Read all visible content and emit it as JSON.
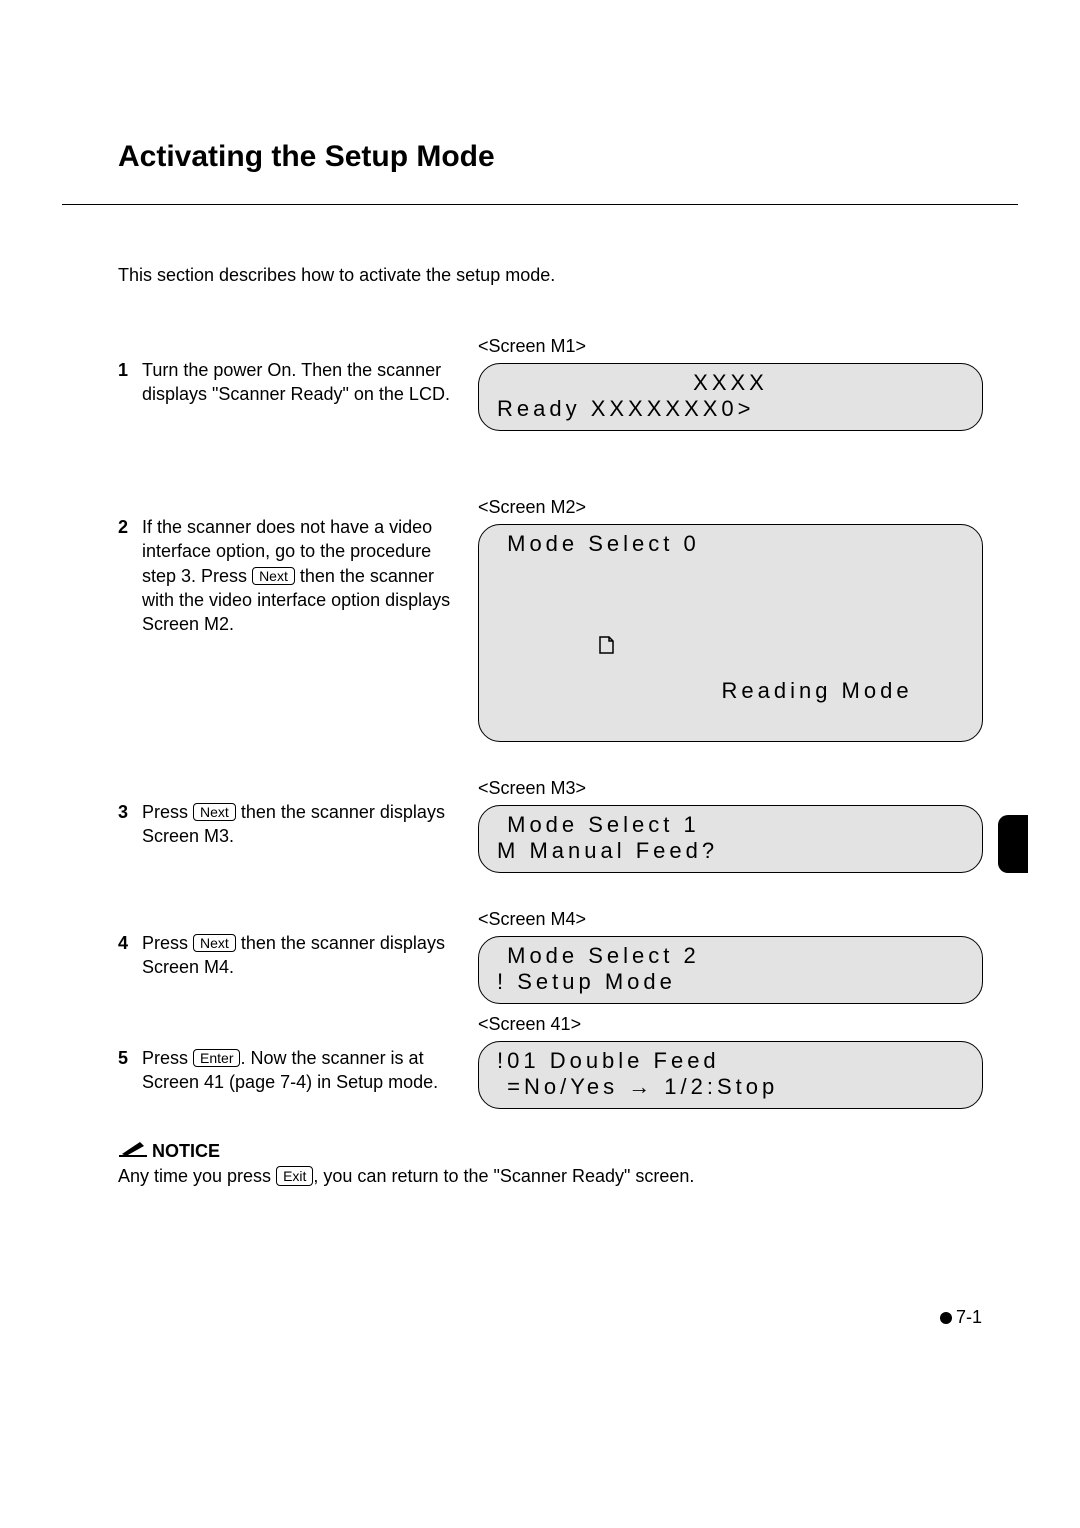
{
  "title": "Activating the Setup Mode",
  "intro": "This section describes how to activate the setup mode.",
  "steps": [
    {
      "num": "1",
      "text_a": "Turn the power On. Then the scanner displays \"Scanner Ready\" on the LCD.",
      "key": "",
      "text_b": ""
    },
    {
      "num": "2",
      "text_a": "If the scanner does not have a video interface option, go to the procedure step 3. Press ",
      "key": "Next",
      "text_b": " then the scanner with the video interface option displays Screen M2."
    },
    {
      "num": "3",
      "text_a": "Press ",
      "key": "Next",
      "text_b": " then the scanner displays Screen M3."
    },
    {
      "num": "4",
      "text_a": "Press ",
      "key": "Next",
      "text_b": " then the scanner displays Screen M4."
    },
    {
      "num": "5",
      "text_a": "Press ",
      "key": "Enter",
      "text_b": ". Now the scanner is at Screen 41 (page 7-4) in Setup mode."
    }
  ],
  "screens": [
    {
      "label": "<Screen M1>",
      "line1": "XXXX",
      "line1_center": true,
      "line2": "Ready XXXXXXX0>",
      "has_icon": false
    },
    {
      "label": "<Screen M2>",
      "line1": " Mode Select 0",
      "line1_center": false,
      "line2": "Reading Mode",
      "has_icon": true
    },
    {
      "label": "<Screen M3>",
      "line1": " Mode Select 1",
      "line1_center": false,
      "line2": "M Manual Feed?",
      "has_icon": false
    },
    {
      "label": "<Screen M4>",
      "line1": " Mode Select 2",
      "line1_center": false,
      "line2": "! Setup Mode",
      "has_icon": false
    },
    {
      "label": "<Screen 41>",
      "line1": "!01 Double Feed",
      "line1_center": false,
      "line2": " =No/Yes → 1/2:Stop",
      "has_icon": false
    }
  ],
  "notice": {
    "label": "NOTICE",
    "text_a": "Any time you press ",
    "key": "Exit",
    "text_b": ", you can return to the \"Scanner Ready\" screen."
  },
  "page_number": "7-1"
}
